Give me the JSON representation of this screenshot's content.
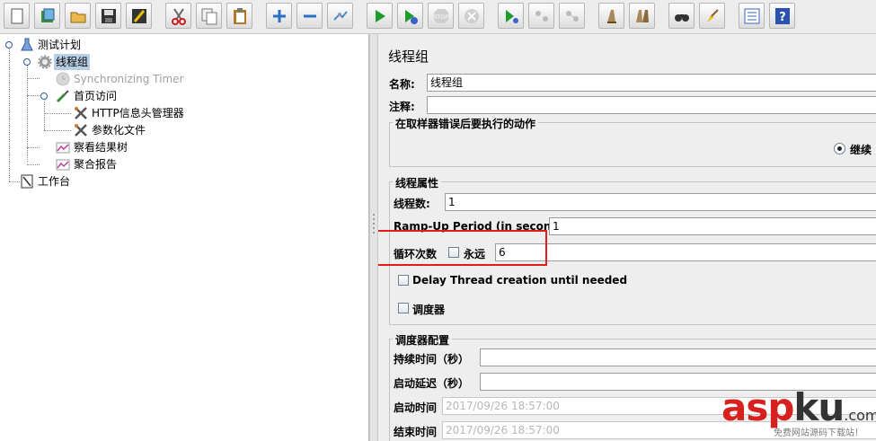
{
  "toolbar": {
    "buttons": [
      "new-icon",
      "templates-icon",
      "open-icon",
      "save-icon",
      "save-as-icon",
      "cut-icon",
      "copy-icon",
      "paste-icon",
      "expand-icon",
      "collapse-icon",
      "toggle-icon",
      "start-icon",
      "start-no-pause-icon",
      "stop-icon",
      "shutdown-icon",
      "remote-start-icon",
      "remote-stop-icon",
      "remote-shutdown-icon",
      "clear-icon",
      "clear-all-icon",
      "search-icon",
      "reset-search-icon",
      "function-helper-icon",
      "help-icon"
    ]
  },
  "tree": {
    "test_plan": "测试计划",
    "thread_group": "线程组",
    "sync_timer": "Synchronizing Timer",
    "http_sampler": "首页访问",
    "header_manager": "HTTP信息头管理器",
    "csv_data": "参数化文件",
    "view_results": "察看结果树",
    "aggregate_report": "聚合报告",
    "workbench": "工作台"
  },
  "panel": {
    "title": "线程组",
    "name_label": "名称:",
    "name_value": "线程组",
    "comment_label": "注释:",
    "comment_value": "",
    "error_group_title": "在取样器错误后要执行的动作",
    "error_option_selected": "继续",
    "props_title": "线程属性",
    "threads_label": "线程数:",
    "threads_value": "1",
    "rampup_label": "Ramp-Up Period (in seconds):",
    "rampup_value": "1",
    "loop_label": "循环次数",
    "forever_label": "永远",
    "forever_checked": false,
    "loop_value": "6",
    "delay_label": "Delay Thread creation until needed",
    "delay_checked": false,
    "scheduler_label": "调度器",
    "scheduler_checked": false,
    "sched_title": "调度器配置",
    "duration_label": "持续时间（秒）",
    "duration_value": "",
    "startup_delay_label": "启动延迟（秒）",
    "startup_delay_value": "",
    "start_time_label": "启动时间",
    "start_time_value": "2017/09/26 18:57:00",
    "end_time_label": "结束时间",
    "end_time_value": "2017/09/26 18:57:00"
  },
  "watermark": {
    "logo_a": "asp",
    "logo_b": "ku",
    "logo_c": ".com",
    "tagline": "免费网站源码下载站！"
  },
  "colors": {
    "highlight_box": "#e21b1b",
    "selection": "#b8cfe5",
    "watermark_red": "#d8201f",
    "watermark_dark": "#333333"
  }
}
